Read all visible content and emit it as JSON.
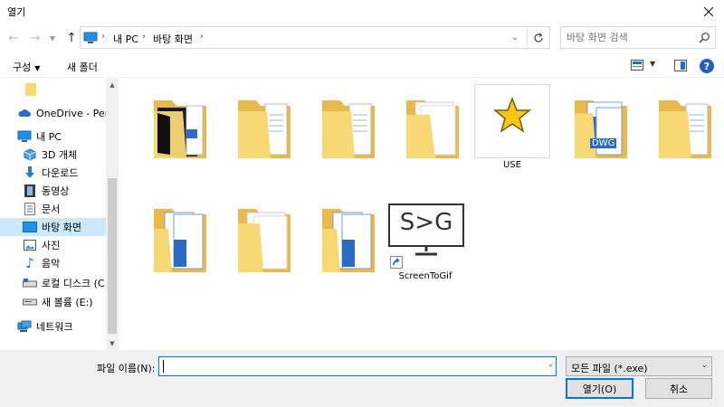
{
  "window": {
    "title": "열기"
  },
  "address": {
    "segments": [
      "내 PC",
      "바탕 화면"
    ]
  },
  "search": {
    "placeholder": "바탕 화면 검색"
  },
  "toolbar": {
    "organize_label": "구성",
    "new_folder_label": "새 폴더"
  },
  "nav": {
    "items": [
      {
        "label": ""
      },
      {
        "label": "OneDrive - Person"
      },
      {
        "label": "내 PC"
      },
      {
        "label": "3D 개체"
      },
      {
        "label": "다운로드"
      },
      {
        "label": "동영상"
      },
      {
        "label": "문서"
      },
      {
        "label": "바탕 화면"
      },
      {
        "label": "사진"
      },
      {
        "label": "음악"
      },
      {
        "label": "로컬 디스크 (C:)"
      },
      {
        "label": "새 볼륨 (E:)"
      },
      {
        "label": "네트워크"
      }
    ]
  },
  "files": [
    {
      "label": "",
      "kind": "folder-dark"
    },
    {
      "label": "",
      "kind": "folder-doc"
    },
    {
      "label": "",
      "kind": "folder-doc"
    },
    {
      "label": "",
      "kind": "folder-blank"
    },
    {
      "label": "USE",
      "kind": "star-app"
    },
    {
      "label": "",
      "kind": "folder-dwg"
    },
    {
      "label": "",
      "kind": "folder-doc"
    },
    {
      "label": "",
      "kind": "folder-blue"
    },
    {
      "label": "",
      "kind": "folder-blank"
    },
    {
      "label": "",
      "kind": "folder-blue"
    },
    {
      "label": "ScreenToGif",
      "kind": "screentogif"
    }
  ],
  "screentogif_icon_text": "S>G",
  "dwg_text": "DWG",
  "bottom": {
    "filename_label": "파일 이름(N):",
    "filename_value": "",
    "filetype_value": "모든 파일 (*.exe)",
    "open_label": "열기(O)",
    "cancel_label": "취소"
  },
  "colors": {
    "selection": "#cce8ff",
    "accent": "#0078d7",
    "folder": "#f8d775"
  }
}
